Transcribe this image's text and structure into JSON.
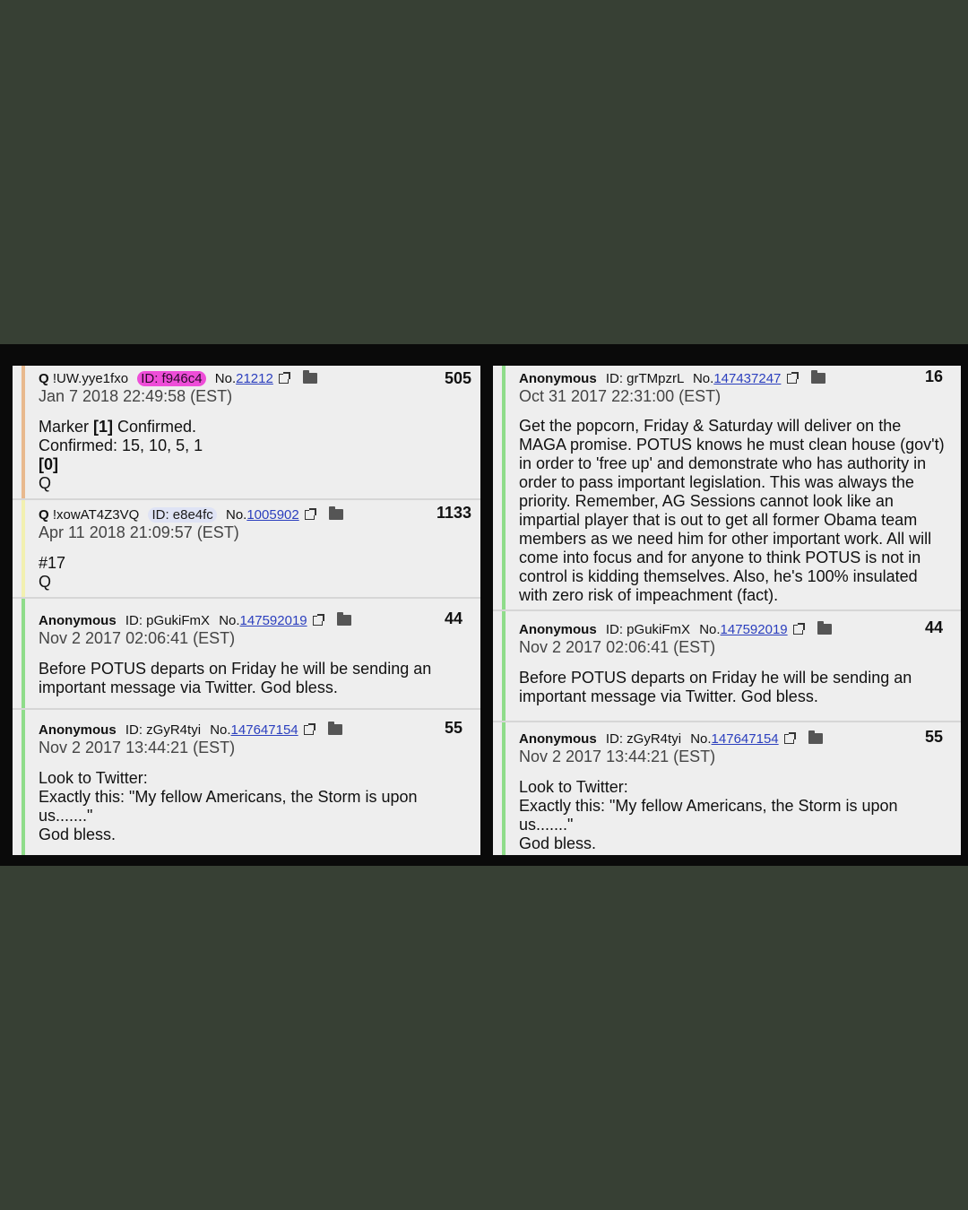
{
  "left_panel": {
    "posts": [
      {
        "name": "Q",
        "trip": "!UW.yye1fxo",
        "id": "ID: f946c4",
        "no_prefix": "No.",
        "no": "21212",
        "date": "Jan 7 2018 22:49:58 (EST)",
        "count": "505",
        "body": {
          "l1a": "Marker ",
          "l1b": "[1]",
          "l1c": " Confirmed.",
          "l2": "Confirmed: 15, 10, 5, 1",
          "l3": "[0]",
          "l4": "Q"
        }
      },
      {
        "name": "Q",
        "trip": "!xowAT4Z3VQ",
        "id": "ID: e8e4fc",
        "no_prefix": "No.",
        "no": "1005902",
        "date": "Apr 11 2018 21:09:57 (EST)",
        "count": "1133",
        "body": {
          "l1": "#17",
          "l2": "Q"
        }
      },
      {
        "name": "Anonymous",
        "id": "ID: pGukiFmX",
        "no_prefix": "No.",
        "no": "147592019",
        "date": "Nov 2 2017 02:06:41 (EST)",
        "count": "44",
        "body": {
          "l1": "Before POTUS departs on Friday he will be sending an",
          "l2": "important message via Twitter. God bless."
        }
      },
      {
        "name": "Anonymous",
        "id": "ID: zGyR4tyi",
        "no_prefix": "No.",
        "no": "147647154",
        "date": "Nov 2 2017 13:44:21 (EST)",
        "count": "55",
        "body": {
          "l1": "Look to Twitter:",
          "l2": "Exactly this: \"My fellow Americans, the Storm is upon",
          "l3": "us.......\"",
          "l4": "God bless."
        }
      }
    ]
  },
  "right_panel": {
    "posts": [
      {
        "name": "Anonymous",
        "id": "ID: grTMpzrL",
        "no_prefix": "No.",
        "no": "147437247",
        "date": "Oct 31 2017 22:31:00 (EST)",
        "count": "16",
        "body": {
          "lines": [
            "Get the popcorn, Friday & Saturday will deliver on the",
            "MAGA promise. POTUS knows he must clean house (gov't)",
            "in order to 'free up' and demonstrate who has authority in",
            "order to pass important legislation. This was always the",
            "priority. Remember, AG Sessions cannot look like an",
            "impartial player that is out to get all former Obama team",
            "members as we need him for other important work. All will",
            "come into focus and for anyone to think POTUS is not in",
            "control is kidding themselves. Also, he's 100% insulated",
            "with zero risk of impeachment (fact)."
          ]
        }
      },
      {
        "name": "Anonymous",
        "id": "ID: pGukiFmX",
        "no_prefix": "No.",
        "no": "147592019",
        "date": "Nov 2 2017 02:06:41 (EST)",
        "count": "44",
        "body": {
          "l1": "Before POTUS departs on Friday he will be sending an",
          "l2": "important message via Twitter. God bless."
        }
      },
      {
        "name": "Anonymous",
        "id": "ID: zGyR4tyi",
        "no_prefix": "No.",
        "no": "147647154",
        "date": "Nov 2 2017 13:44:21 (EST)",
        "count": "55",
        "body": {
          "l1": "Look to Twitter:",
          "l2": "Exactly this: \"My fellow Americans, the Storm is upon",
          "l3": "us.......\"",
          "l4": "God bless."
        }
      }
    ]
  },
  "colors": {
    "background": "#374034",
    "bar_q1": "#e8b98e",
    "bar_q2": "#f2f0b0",
    "bar_green": "#8fdc8a",
    "id_pink": "#ee4dd8",
    "link": "#2b3fbe"
  },
  "icons": {
    "external": "external-link-icon",
    "folder": "folder-icon"
  }
}
